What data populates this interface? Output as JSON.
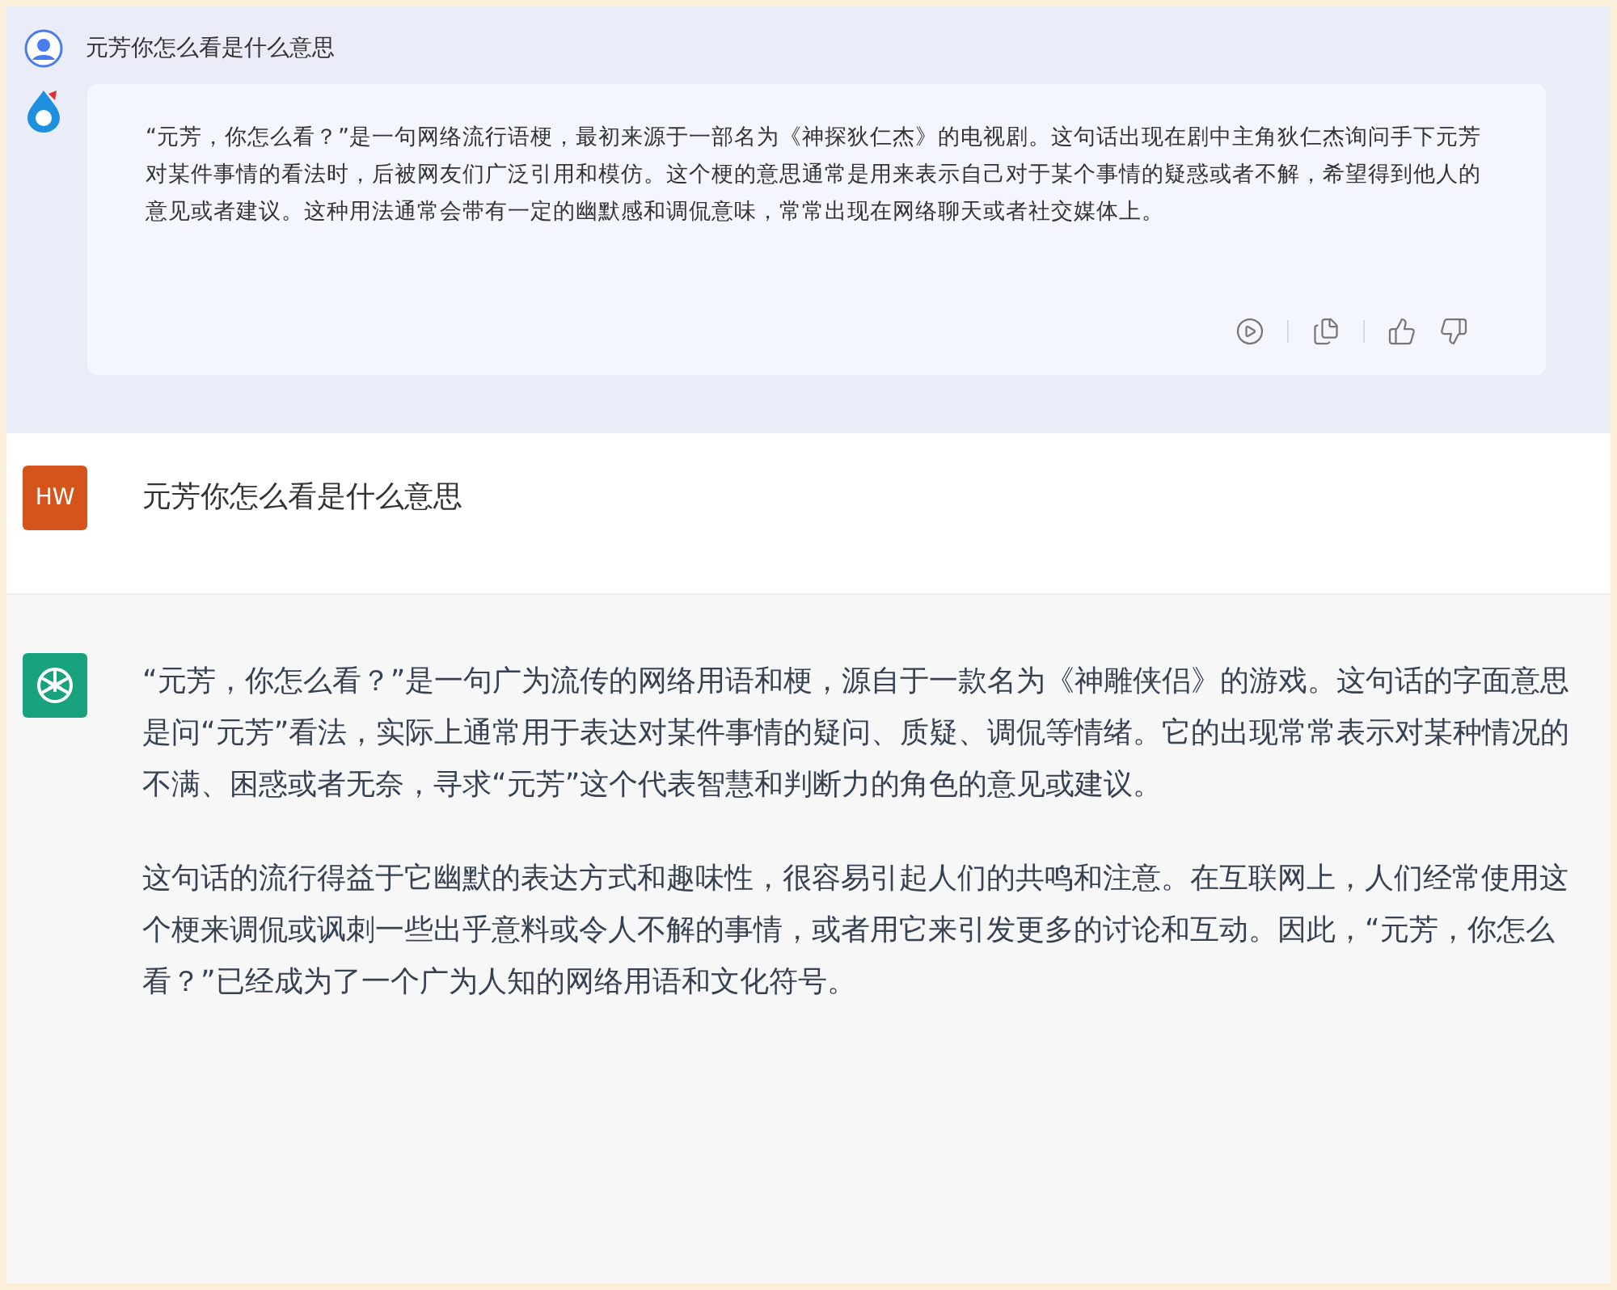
{
  "first_chat": {
    "question": "元芳你怎么看是什么意思",
    "answer": "“元芳，你怎么看？”是一句网络流行语梗，最初来源于一部名为《神探狄仁杰》的电视剧。这句话出现在剧中主角狄仁杰询问手下元芳对某件事情的看法时，后被网友们广泛引用和模仿。这个梗的意思通常是用来表示自己对于某个事情的疑惑或者不解，希望得到他人的意见或者建议。这种用法通常会带有一定的幽默感和调侃意味，常常出现在网络聊天或者社交媒体上。"
  },
  "second_chat": {
    "user_initials": "HW",
    "question": "元芳你怎么看是什么意思",
    "answer_paragraphs": [
      "“元芳，你怎么看？”是一句广为流传的网络用语和梗，源自于一款名为《神雕侠侣》的游戏。这句话的字面意思是问“元芳”看法，实际上通常用于表达对某件事情的疑问、质疑、调侃等情绪。它的出现常常表示对某种情况的不满、困惑或者无奈，寻求“元芳”这个代表智慧和判断力的角色的意见或建议。",
      "这句话的流行得益于它幽默的表达方式和趣味性，很容易引起人们的共鸣和注意。在互联网上，人们经常使用这个梗来调侃或讽刺一些出乎意料或令人不解的事情，或者用它来引发更多的讨论和互动。因此，“元芳，你怎么看？”已经成为了一个广为人知的网络用语和文化符号。"
    ]
  }
}
